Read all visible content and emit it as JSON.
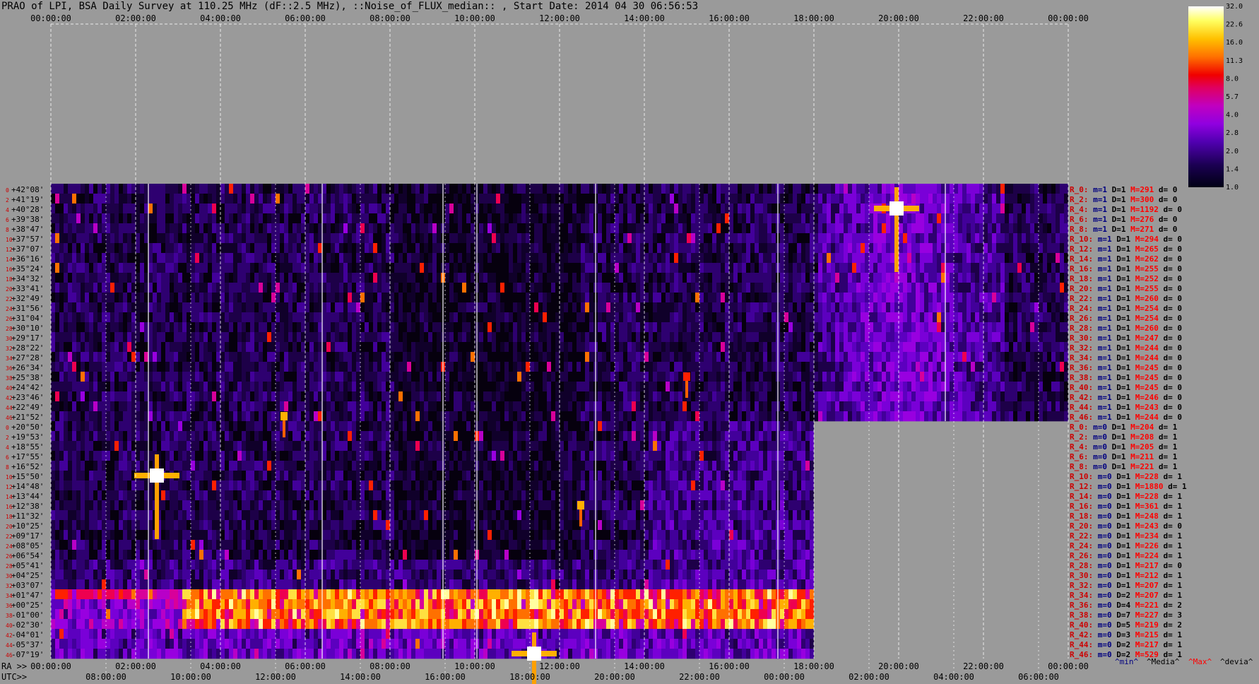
{
  "title": "PRAO of LPI, BSA Daily Survey at 110.25 MHz (dF::2.5 MHz), ::Noise_of_FLUX_median:: , Start Date: 2014 04 30 06:56:53",
  "axes": {
    "top_ticks": [
      "00:00:00",
      "02:00:00",
      "04:00:00",
      "06:00:00",
      "08:00:00",
      "10:00:00",
      "12:00:00",
      "14:00:00",
      "16:00:00",
      "18:00:00",
      "20:00:00",
      "22:00:00",
      "00:00:00"
    ],
    "ra_label": "RA >>",
    "ra_ticks": [
      "00:00:00",
      "02:00:00",
      "04:00:00",
      "06:00:00",
      "08:00:00",
      "10:00:00",
      "12:00:00",
      "14:00:00",
      "16:00:00",
      "18:00:00",
      "20:00:00",
      "22:00:00",
      "00:00:00"
    ],
    "utc_label": "UTC>>",
    "utc_ticks": [
      "08:00:00",
      "10:00:00",
      "12:00:00",
      "14:00:00",
      "16:00:00",
      "18:00:00",
      "20:00:00",
      "22:00:00",
      "00:00:00",
      "02:00:00",
      "04:00:00",
      "06:00:00"
    ]
  },
  "colorbar": {
    "labels": [
      "32.0",
      "22.6",
      "16.0",
      "11.3",
      "8.0",
      "5.7",
      "4.0",
      "2.8",
      "2.0",
      "1.4",
      "1.0"
    ]
  },
  "declinations": [
    "+42°08'",
    "+41°19'",
    "+40°28'",
    "+39°38'",
    "+38°47'",
    "+37°57'",
    "+37°07'",
    "+36°16'",
    "+35°24'",
    "+34°32'",
    "+33°41'",
    "+32°49'",
    "+31°56'",
    "+31°04'",
    "+30°10'",
    "+29°17'",
    "+28°22'",
    "+27°28'",
    "+26°34'",
    "+25°38'",
    "+24°42'",
    "+23°46'",
    "+22°49'",
    "+21°52'",
    "+20°50'",
    "+19°53'",
    "+18°55'",
    "+17°55'",
    "+16°52'",
    "+15°50'",
    "+14°48'",
    "+13°44'",
    "+12°38'",
    "+11°32'",
    "+10°25'",
    "+09°17'",
    "+08°05'",
    "+06°54'",
    "+05°41'",
    "+04°25'",
    "+03°07'",
    "+01°47'",
    "+00°25'",
    "-01°00'",
    "-02°30'",
    "-04°01'",
    "-05°37'",
    "-07°19'"
  ],
  "row_numbers": [
    "0",
    "2",
    "4",
    "6",
    "8",
    "10",
    "12",
    "14",
    "16",
    "18",
    "20",
    "22",
    "24",
    "26",
    "28",
    "30",
    "32",
    "34",
    "36",
    "38",
    "40",
    "42",
    "44",
    "46",
    "0",
    "2",
    "4",
    "6",
    "8",
    "10",
    "12",
    "14",
    "16",
    "18",
    "20",
    "22",
    "24",
    "26",
    "28",
    "30",
    "32",
    "34",
    "36",
    "38",
    "40",
    "42",
    "44",
    "46"
  ],
  "stats": [
    {
      "r": "R_0:",
      "m": "m=1",
      "d": "D=1",
      "M": "M=291",
      "dd": "d= 0"
    },
    {
      "r": "R_2:",
      "m": "m=1",
      "d": "D=1",
      "M": "M=300",
      "dd": "d= 0"
    },
    {
      "r": "R_4:",
      "m": "m=1",
      "d": "D=1",
      "M": "M=1192",
      "dd": "d= 0"
    },
    {
      "r": "R_6:",
      "m": "m=1",
      "d": "D=1",
      "M": "M=276",
      "dd": "d= 0"
    },
    {
      "r": "R_8:",
      "m": "m=1",
      "d": "D=1",
      "M": "M=271",
      "dd": "d= 0"
    },
    {
      "r": "R_10:",
      "m": "m=1",
      "d": "D=1",
      "M": "M=294",
      "dd": "d= 0"
    },
    {
      "r": "R_12:",
      "m": "m=1",
      "d": "D=1",
      "M": "M=265",
      "dd": "d= 0"
    },
    {
      "r": "R_14:",
      "m": "m=1",
      "d": "D=1",
      "M": "M=262",
      "dd": "d= 0"
    },
    {
      "r": "R_16:",
      "m": "m=1",
      "d": "D=1",
      "M": "M=255",
      "dd": "d= 0"
    },
    {
      "r": "R_18:",
      "m": "m=1",
      "d": "D=1",
      "M": "M=252",
      "dd": "d= 0"
    },
    {
      "r": "R_20:",
      "m": "m=1",
      "d": "D=1",
      "M": "M=255",
      "dd": "d= 0"
    },
    {
      "r": "R_22:",
      "m": "m=1",
      "d": "D=1",
      "M": "M=260",
      "dd": "d= 0"
    },
    {
      "r": "R_24:",
      "m": "m=1",
      "d": "D=1",
      "M": "M=254",
      "dd": "d= 0"
    },
    {
      "r": "R_26:",
      "m": "m=1",
      "d": "D=1",
      "M": "M=254",
      "dd": "d= 0"
    },
    {
      "r": "R_28:",
      "m": "m=1",
      "d": "D=1",
      "M": "M=260",
      "dd": "d= 0"
    },
    {
      "r": "R_30:",
      "m": "m=1",
      "d": "D=1",
      "M": "M=247",
      "dd": "d= 0"
    },
    {
      "r": "R_32:",
      "m": "m=1",
      "d": "D=1",
      "M": "M=244",
      "dd": "d= 0"
    },
    {
      "r": "R_34:",
      "m": "m=1",
      "d": "D=1",
      "M": "M=244",
      "dd": "d= 0"
    },
    {
      "r": "R_36:",
      "m": "m=1",
      "d": "D=1",
      "M": "M=245",
      "dd": "d= 0"
    },
    {
      "r": "R_38:",
      "m": "m=1",
      "d": "D=1",
      "M": "M=245",
      "dd": "d= 0"
    },
    {
      "r": "R_40:",
      "m": "m=1",
      "d": "D=1",
      "M": "M=245",
      "dd": "d= 0"
    },
    {
      "r": "R_42:",
      "m": "m=1",
      "d": "D=1",
      "M": "M=246",
      "dd": "d= 0"
    },
    {
      "r": "R_44:",
      "m": "m=1",
      "d": "D=1",
      "M": "M=243",
      "dd": "d= 0"
    },
    {
      "r": "R_46:",
      "m": "m=1",
      "d": "D=1",
      "M": "M=244",
      "dd": "d= 0"
    },
    {
      "r": "R_0:",
      "m": "m=0",
      "d": "D=1",
      "M": "M=204",
      "dd": "d= 1"
    },
    {
      "r": "R_2:",
      "m": "m=0",
      "d": "D=1",
      "M": "M=208",
      "dd": "d= 1"
    },
    {
      "r": "R_4:",
      "m": "m=0",
      "d": "D=1",
      "M": "M=205",
      "dd": "d= 1"
    },
    {
      "r": "R_6:",
      "m": "m=0",
      "d": "D=1",
      "M": "M=211",
      "dd": "d= 1"
    },
    {
      "r": "R_8:",
      "m": "m=0",
      "d": "D=1",
      "M": "M=221",
      "dd": "d= 1"
    },
    {
      "r": "R_10:",
      "m": "m=0",
      "d": "D=1",
      "M": "M=228",
      "dd": "d= 1"
    },
    {
      "r": "R_12:",
      "m": "m=0",
      "d": "D=1",
      "M": "M=1880",
      "dd": "d= 1"
    },
    {
      "r": "R_14:",
      "m": "m=0",
      "d": "D=1",
      "M": "M=228",
      "dd": "d= 1"
    },
    {
      "r": "R_16:",
      "m": "m=0",
      "d": "D=1",
      "M": "M=361",
      "dd": "d= 1"
    },
    {
      "r": "R_18:",
      "m": "m=0",
      "d": "D=1",
      "M": "M=248",
      "dd": "d= 1"
    },
    {
      "r": "R_20:",
      "m": "m=0",
      "d": "D=1",
      "M": "M=243",
      "dd": "d= 0"
    },
    {
      "r": "R_22:",
      "m": "m=0",
      "d": "D=1",
      "M": "M=234",
      "dd": "d= 1"
    },
    {
      "r": "R_24:",
      "m": "m=0",
      "d": "D=1",
      "M": "M=226",
      "dd": "d= 1"
    },
    {
      "r": "R_26:",
      "m": "m=0",
      "d": "D=1",
      "M": "M=224",
      "dd": "d= 1"
    },
    {
      "r": "R_28:",
      "m": "m=0",
      "d": "D=1",
      "M": "M=217",
      "dd": "d= 0"
    },
    {
      "r": "R_30:",
      "m": "m=0",
      "d": "D=1",
      "M": "M=212",
      "dd": "d= 1"
    },
    {
      "r": "R_32:",
      "m": "m=0",
      "d": "D=1",
      "M": "M=207",
      "dd": "d= 1"
    },
    {
      "r": "R_34:",
      "m": "m=0",
      "d": "D=2",
      "M": "M=207",
      "dd": "d= 1"
    },
    {
      "r": "R_36:",
      "m": "m=0",
      "d": "D=4",
      "M": "M=221",
      "dd": "d= 2"
    },
    {
      "r": "R_38:",
      "m": "m=0",
      "d": "D=7",
      "M": "M=227",
      "dd": "d= 3"
    },
    {
      "r": "R_40:",
      "m": "m=0",
      "d": "D=5",
      "M": "M=219",
      "dd": "d= 2"
    },
    {
      "r": "R_42:",
      "m": "m=0",
      "d": "D=3",
      "M": "M=215",
      "dd": "d= 1"
    },
    {
      "r": "R_44:",
      "m": "m=0",
      "d": "D=2",
      "M": "M=217",
      "dd": "d= 1"
    },
    {
      "r": "R_46:",
      "m": "m=0",
      "d": "D=2",
      "M": "M=529",
      "dd": "d= 1"
    }
  ],
  "legend": [
    "^min^",
    "^Media^",
    "^Max^",
    "^devia^"
  ],
  "colors": {
    "background": "#9a9a9a",
    "min": "#000080",
    "max": "#ff0000",
    "label_red": "#cc0000"
  },
  "chart_data": {
    "type": "heatmap",
    "title": "PRAO of LPI, BSA Daily Survey at 110.25 MHz (dF::2.5 MHz), ::Noise_of_FLUX_median:: , Start Date: 2014 04 30 06:56:53",
    "x_axis_ra": [
      "00:00:00",
      "02:00:00",
      "04:00:00",
      "06:00:00",
      "08:00:00",
      "10:00:00",
      "12:00:00",
      "14:00:00",
      "16:00:00",
      "18:00:00",
      "20:00:00",
      "22:00:00",
      "00:00:00"
    ],
    "x_axis_utc": [
      "08:00:00",
      "10:00:00",
      "12:00:00",
      "14:00:00",
      "16:00:00",
      "18:00:00",
      "20:00:00",
      "22:00:00",
      "00:00:00",
      "02:00:00",
      "04:00:00",
      "06:00:00"
    ],
    "color_scale": [
      1.0,
      1.4,
      2.0,
      2.8,
      4.0,
      5.7,
      8.0,
      11.3,
      16.0,
      22.6,
      32.0
    ],
    "rows": 48,
    "group_1_end_ra_hour": 24,
    "group_2_end_ra_hour": 18,
    "bright_sources": [
      {
        "ra_hour": 19.95,
        "dec": "+40°28'",
        "intensity": 32
      },
      {
        "ra_hour": 2.5,
        "dec": "+15°50'",
        "intensity": 32
      },
      {
        "ra_hour": 11.4,
        "dec": "-07°19'",
        "intensity": 32
      },
      {
        "ra_hour": 5.5,
        "dec": "+21°52'",
        "intensity": 16
      },
      {
        "ra_hour": 12.5,
        "dec": "+12°38'",
        "intensity": 16
      },
      {
        "ra_hour": 15.0,
        "dec": "+25°38'",
        "intensity": 11.3
      }
    ],
    "galactic_band": {
      "dec_from": "+01°47'",
      "dec_to": "-02°30'",
      "intensity": 16
    }
  }
}
